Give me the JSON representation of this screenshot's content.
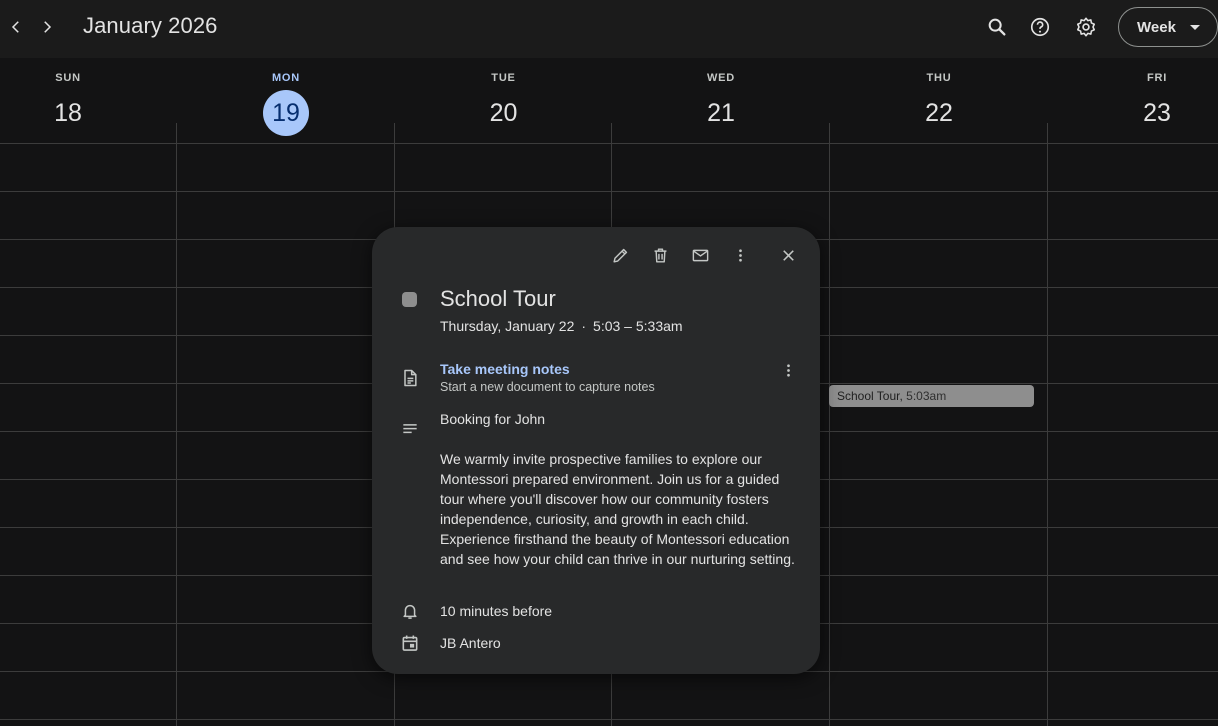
{
  "header": {
    "month_title": "January 2026",
    "view_label": "Week"
  },
  "days": [
    {
      "name": "SUN",
      "num": "18"
    },
    {
      "name": "MON",
      "num": "19",
      "today": true
    },
    {
      "name": "TUE",
      "num": "20"
    },
    {
      "name": "WED",
      "num": "21"
    },
    {
      "name": "THU",
      "num": "22"
    },
    {
      "name": "FRI",
      "num": "23"
    }
  ],
  "event_chip": {
    "title": "School Tour,",
    "time": " 5:03am"
  },
  "popup": {
    "title": "School Tour",
    "date": "Thursday, January 22",
    "time": "5:03 – 5:33am",
    "notes_link": "Take meeting notes",
    "notes_sub": "Start a new document to capture notes",
    "desc_first": "Booking for John",
    "desc_body": "We warmly invite prospective families to explore our Montessori prepared environment. Join us for a guided tour where you'll discover how our community fosters independence, curiosity, and growth in each child. Experience firsthand the beauty of Montessori education and see how your child can thrive in our nurturing setting.",
    "reminder": "10 minutes before",
    "calendar": "JB Antero"
  },
  "colors": {
    "accent": "#a8c7fa",
    "event": "#8e8e8e",
    "popup_bg": "#28292a",
    "page_bg": "#131314"
  }
}
